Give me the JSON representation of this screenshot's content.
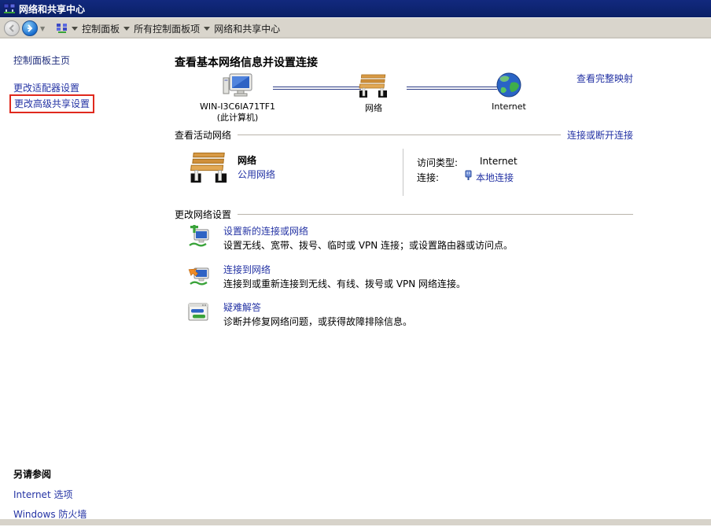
{
  "titlebar": {
    "title": "网络和共享中心"
  },
  "navbar": {
    "breadcrumb": {
      "items": [
        "控制面板",
        "所有控制面板项",
        "网络和共享中心"
      ]
    }
  },
  "sidebar": {
    "home_label": "控制面板主页",
    "links": [
      {
        "label": "更改适配器设置"
      },
      {
        "label": "更改高级共享设置",
        "highlighted": true
      }
    ]
  },
  "main": {
    "heading": "查看基本网络信息并设置连接",
    "full_map_link": "查看完整映射",
    "map": {
      "computer_name": "WIN-I3C6IA71TF1",
      "computer_sub": "(此计算机)",
      "network_label": "网络",
      "internet_label": "Internet"
    },
    "active": {
      "title": "查看活动网络",
      "action_link": "连接或断开连接",
      "network_name": "网络",
      "network_type": "公用网络",
      "details": [
        {
          "label": "访问类型:",
          "value": "Internet"
        },
        {
          "label": "连接:",
          "value": "本地连接"
        }
      ]
    },
    "settings": {
      "title": "更改网络设置",
      "tasks": [
        {
          "icon": "new-connection-icon",
          "title": "设置新的连接或网络",
          "desc": "设置无线、宽带、拨号、临时或 VPN 连接；或设置路由器或访问点。"
        },
        {
          "icon": "connect-to-network-icon",
          "title": "连接到网络",
          "desc": "连接到或重新连接到无线、有线、拨号或 VPN 网络连接。"
        },
        {
          "icon": "troubleshoot-icon",
          "title": "疑难解答",
          "desc": "诊断并修复网络问题，或获得故障排除信息。"
        }
      ]
    }
  },
  "see_also": {
    "title": "另请参阅",
    "links": [
      "Internet 选项",
      "Windows 防火墙"
    ]
  },
  "colors": {
    "titlebar": "#0E2472",
    "toolbar": "#D9D5CC",
    "link": "#2433A4",
    "highlight_red": "#E0291D"
  }
}
